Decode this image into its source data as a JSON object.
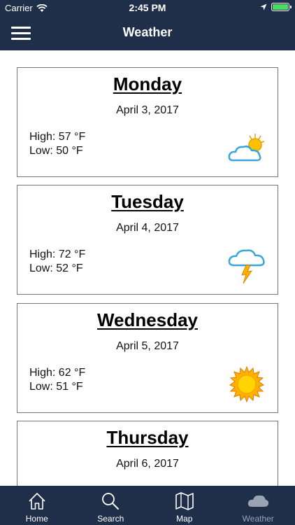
{
  "status_bar": {
    "carrier": "Carrier",
    "time": "2:45 PM"
  },
  "header": {
    "title": "Weather"
  },
  "forecast": [
    {
      "day": "Monday",
      "date": "April 3, 2017",
      "high": "High: 57 °F",
      "low": "Low: 50 °F",
      "icon": "partly-cloudy-icon"
    },
    {
      "day": "Tuesday",
      "date": "April 4, 2017",
      "high": "High: 72 °F",
      "low": "Low: 52 °F",
      "icon": "thunderstorm-icon"
    },
    {
      "day": "Wednesday",
      "date": "April 5, 2017",
      "high": "High: 62 °F",
      "low": "Low: 51 °F",
      "icon": "sunny-icon"
    },
    {
      "day": "Thursday",
      "date": "April 6, 2017",
      "high": "",
      "low": "",
      "icon": "partly-cloudy-icon"
    }
  ],
  "tabbar": {
    "items": [
      {
        "label": "Home",
        "icon": "home-icon"
      },
      {
        "label": "Search",
        "icon": "search-icon"
      },
      {
        "label": "Map",
        "icon": "map-icon"
      },
      {
        "label": "Weather",
        "icon": "cloud-icon",
        "active": true
      }
    ]
  },
  "colors": {
    "bar_background": "#1f2f4a",
    "active_tab": "#9aa3b3",
    "battery": "#4cd964"
  }
}
